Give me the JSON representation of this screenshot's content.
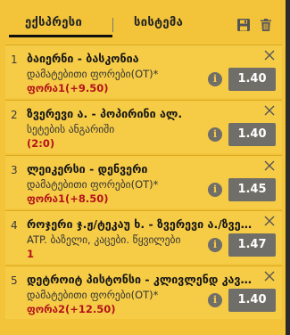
{
  "tabs": {
    "express": "ექსპრესი",
    "system": "სისტემა"
  },
  "icons": {
    "save": "save-icon",
    "trash": "trash-icon",
    "close": "close-icon",
    "info": "info-icon"
  },
  "colors": {
    "panel": "#f3c43a",
    "row": "#f6cc47",
    "odds_button": "#6f6e68",
    "pick_text": "#b3121a"
  },
  "bets": [
    {
      "index": "1",
      "title": "ბაიერნი - ბასკონია",
      "market": "დამატებითი ფორები(OT)*",
      "pick": "ფორა1(+9.50)",
      "odds": "1.40"
    },
    {
      "index": "2",
      "title": "ზვერევი ა. - პოპირინი ალ.",
      "market": "სეტების ანგარიში",
      "pick": "(2:0)",
      "odds": "1.40"
    },
    {
      "index": "3",
      "title": "ლეიკერსი - დენვერი",
      "market": "დამატებითი ფორები(OT)*",
      "pick": "ფორა1(+8.50)",
      "odds": "1.45"
    },
    {
      "index": "4",
      "title": "როჯერი ჯ.ჟ/ტეკაუ ხ. - ზვერევი ა./ზვერევი მ.",
      "market": "ATP. ბაზელი, კაცები. წყვილები",
      "pick": "1",
      "odds": "1.47"
    },
    {
      "index": "5",
      "title": "დეტროიტ პისტონსი - კლივლენდ კავალიერსი",
      "market": "დამატებითი ფორები(OT)*",
      "pick": "ფორა2(+12.50)",
      "odds": "1.40"
    }
  ]
}
